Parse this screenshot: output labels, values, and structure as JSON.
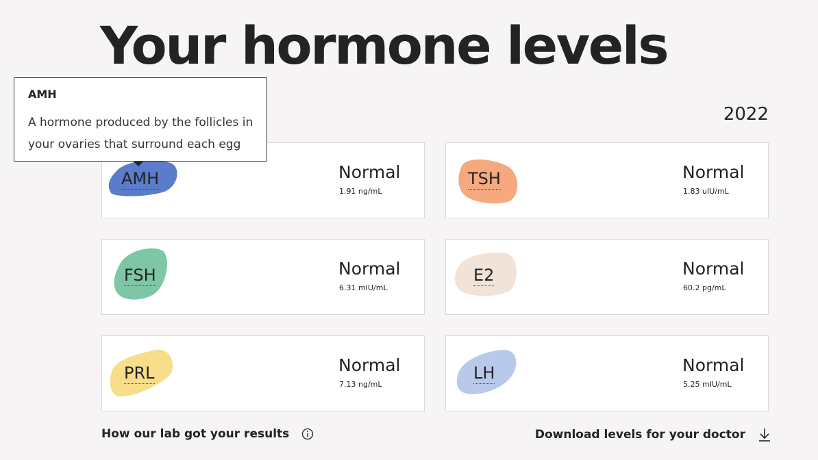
{
  "page": {
    "title": "Your hormone levels",
    "year": "2022"
  },
  "tooltip": {
    "title": "AMH",
    "body": "A hormone produced by the follicles in your ovaries that surround each egg"
  },
  "hormones": [
    {
      "name": "AMH",
      "status": "Normal",
      "value": "1.91 ng/mL",
      "color": "#5a7ccb"
    },
    {
      "name": "TSH",
      "status": "Normal",
      "value": "1.83 uIU/mL",
      "color": "#f6a97f"
    },
    {
      "name": "FSH",
      "status": "Normal",
      "value": "6.31 mIU/mL",
      "color": "#7ec6a6"
    },
    {
      "name": "E2",
      "status": "Normal",
      "value": "60.2 pg/mL",
      "color": "#f2e3d9"
    },
    {
      "name": "PRL",
      "status": "Normal",
      "value": "7.13 ng/mL",
      "color": "#f8dd8b"
    },
    {
      "name": "LH",
      "status": "Normal",
      "value": "5.25 mIU/mL",
      "color": "#b9c9ea"
    }
  ],
  "footer": {
    "lab_link": "How our lab got your results",
    "download_link": "Download levels for your doctor",
    "info_icon": "info-circle-icon",
    "download_icon": "download-arrow-icon"
  }
}
